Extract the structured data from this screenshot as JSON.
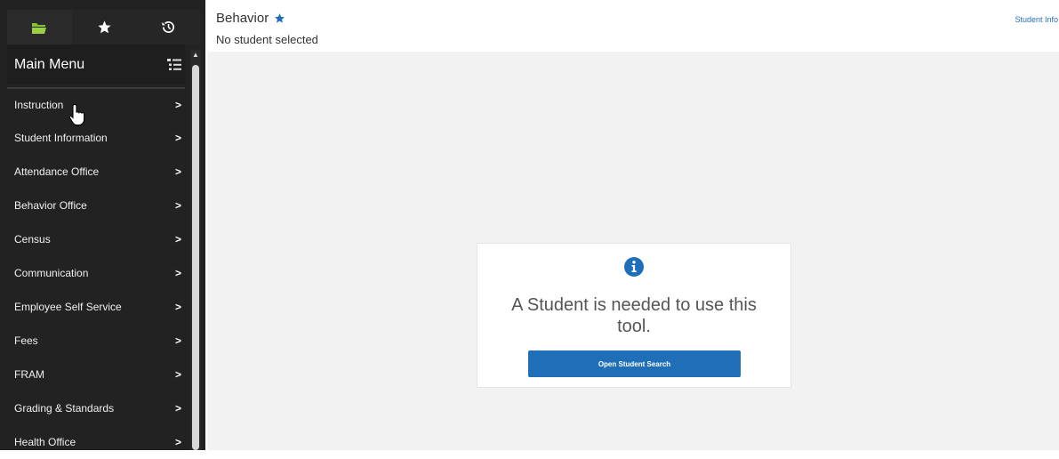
{
  "sidebar": {
    "tabs": [
      {
        "icon": "folder-icon",
        "state": "active"
      },
      {
        "icon": "star-icon"
      },
      {
        "icon": "history-icon"
      }
    ],
    "title": "Main Menu",
    "menu_toggle_icon": "menu-list-icon",
    "items": [
      {
        "label": "Instruction"
      },
      {
        "label": "Student Information"
      },
      {
        "label": "Attendance Office"
      },
      {
        "label": "Behavior Office"
      },
      {
        "label": "Census"
      },
      {
        "label": "Communication"
      },
      {
        "label": "Employee Self Service"
      },
      {
        "label": "Fees"
      },
      {
        "label": "FRAM"
      },
      {
        "label": "Grading & Standards"
      },
      {
        "label": "Health Office"
      }
    ],
    "chevron": ">"
  },
  "header": {
    "title": "Behavior",
    "subtitle": "No student selected",
    "link": "Student Info"
  },
  "notice": {
    "icon": "info-icon",
    "message": "A Student is needed to use this tool.",
    "button_label": "Open Student Search"
  },
  "colors": {
    "sidebar_bg": "#222222",
    "accent": "#1f6fb8",
    "content_bg": "#f2f2f2"
  }
}
